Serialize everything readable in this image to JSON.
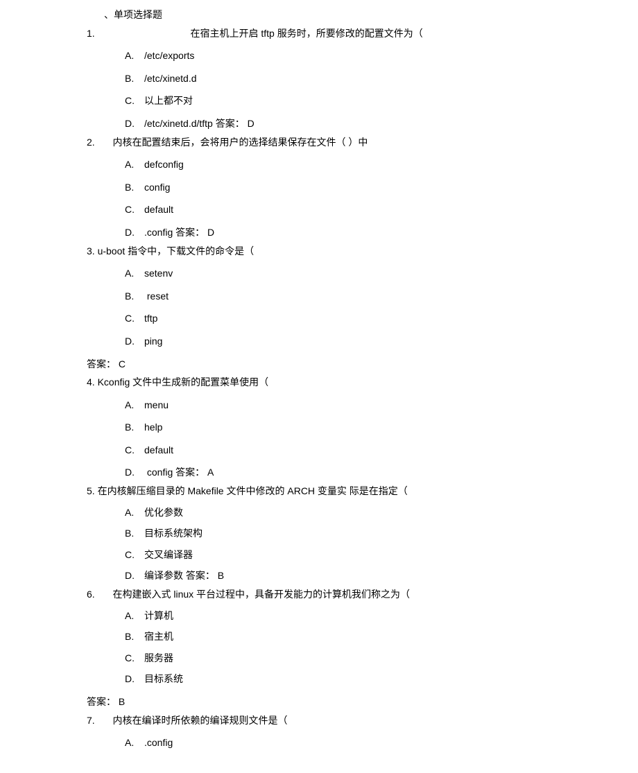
{
  "section_title": "、单项选择题",
  "q1": {
    "num": "1.",
    "text": "在宿主机上开启 tftp 服务时，所要修改的配置文件为（",
    "a": "/etc/exports",
    "b": "/etc/xinetd.d",
    "c": "以上都不对",
    "d": "/etc/xinetd.d/tftp 答案：  D"
  },
  "q2": {
    "num": "2.",
    "text": "内核在配置结束后，会将用户的选择结果保存在文件（  ）中",
    "a": "defconfig",
    "b": "config",
    "c": "default",
    "d": ".config 答案：  D"
  },
  "q3": {
    "num": "3. u-boot 指令中，下载文件的命令是（",
    "a": "setenv",
    "b": "reset",
    "c": "tftp",
    "d": "ping",
    "ans": "答案：  C"
  },
  "q4": {
    "num": "4. Kconfig 文件中生成新的配置菜单使用（",
    "a": "menu",
    "b": "help",
    "c": "default",
    "d": "config 答案：  A"
  },
  "q5": {
    "num": "5. 在内核解压缩目录的  Makefile 文件中修改的  ARCH 变量实  际是在指定（",
    "a": "优化参数",
    "b": "目标系统架构",
    "c": "交叉编译器",
    "d": "编译参数  答案：  B"
  },
  "q6": {
    "num": "6.",
    "text": "在构建嵌入式  linux 平台过程中，具备开发能力的计算机我们称之为（",
    "a": "计算机",
    "b": "宿主机",
    "c": "服务器",
    "d": "目标系统",
    "ans": "答案：  B"
  },
  "q7": {
    "num": "7.",
    "text": "内核在编译时所依赖的编译规则文件是（",
    "a": ".config"
  },
  "labels": {
    "A": "A.",
    "B": "B.",
    "C": "C.",
    "D": "D."
  }
}
